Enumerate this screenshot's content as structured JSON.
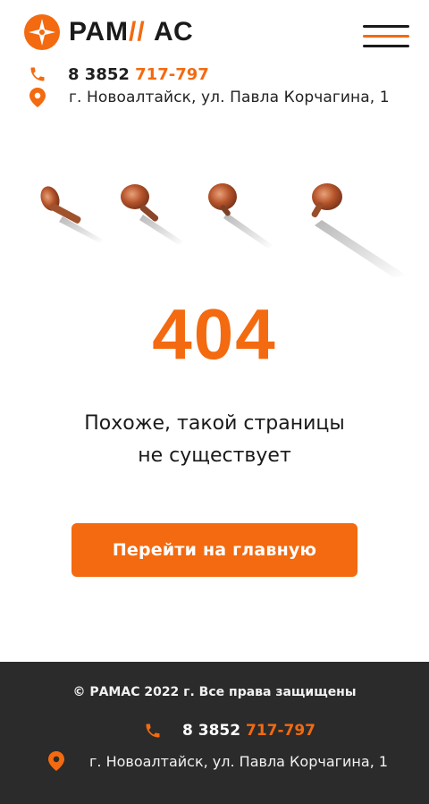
{
  "brand": {
    "logo_text_left": "РАМ",
    "logo_text_accent": "// ",
    "logo_text_right": "АС",
    "accent_color": "#f36a10",
    "dark_color": "#1a1a1a",
    "footer_bg": "#2b2b2b"
  },
  "header": {
    "phone_prefix": "8 3852 ",
    "phone_number": "717-797",
    "address": "г. Новоалтайск, ул. Павла Корчагина, 1",
    "menu_icon": "hamburger-menu-icon"
  },
  "error": {
    "code": "404",
    "message_line1": "Похоже, такой страницы",
    "message_line2": "не существует",
    "button_label": "Перейти на главную"
  },
  "footer": {
    "copyright": "© РАМАС 2022 г. Все права защищены",
    "phone_prefix": "8 3852 ",
    "phone_number": "717-797",
    "address": "г. Новоалтайск, ул. Павла Корчагина, 1"
  },
  "icons": {
    "phone": "phone-icon",
    "location": "location-pin-icon",
    "logo": "star-compass-logo-icon"
  }
}
